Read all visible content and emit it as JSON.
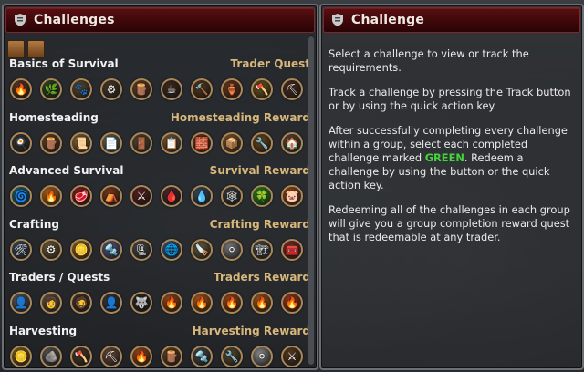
{
  "left_panel": {
    "title": "Challenges",
    "groups": [
      {
        "name": "Basics of Survival",
        "reward": "Trader Quest",
        "icons": [
          {
            "icon": "🔥",
            "color": "#5a3a20"
          },
          {
            "icon": "🌿",
            "color": "#2f4a23"
          },
          {
            "icon": "🐾",
            "color": "#5a4a30"
          },
          {
            "icon": "⚙",
            "color": "#4a3a28"
          },
          {
            "icon": "🪵",
            "color": "#6a4425"
          },
          {
            "icon": "☕",
            "color": "#3e2a1e"
          },
          {
            "icon": "🔨",
            "color": "#5a3a1e"
          },
          {
            "icon": "🏺",
            "color": "#6e3a1c"
          },
          {
            "icon": "🪓",
            "color": "#6d5a20"
          },
          {
            "icon": "⛏",
            "color": "#4a2c20"
          }
        ]
      },
      {
        "name": "Homesteading",
        "reward": "Homesteading Reward",
        "icons": [
          {
            "icon": "🍳",
            "color": "#3a3a3a"
          },
          {
            "icon": "🪵",
            "color": "#6a4425"
          },
          {
            "icon": "📜",
            "color": "#8a6a3a"
          },
          {
            "icon": "📄",
            "color": "#7a6a4a"
          },
          {
            "icon": "🚪",
            "color": "#5a4a35"
          },
          {
            "icon": "📋",
            "color": "#7a6040"
          },
          {
            "icon": "🧱",
            "color": "#7a3a22"
          },
          {
            "icon": "📦",
            "color": "#8a5a2a"
          },
          {
            "icon": "🔧",
            "color": "#6a4a20"
          },
          {
            "icon": "🏠",
            "color": "#5a4a3a"
          }
        ]
      },
      {
        "name": "Advanced Survival",
        "reward": "Survival Reward",
        "icons": [
          {
            "icon": "🌀",
            "color": "#1c6a7a"
          },
          {
            "icon": "🔥",
            "color": "#b06a1a"
          },
          {
            "icon": "🥩",
            "color": "#8a1e1e"
          },
          {
            "icon": "⛺",
            "color": "#7a3a1a"
          },
          {
            "icon": "⚔",
            "color": "#5a2020"
          },
          {
            "icon": "🩸",
            "color": "#4a2a2a"
          },
          {
            "icon": "💧",
            "color": "#3a4a5a"
          },
          {
            "icon": "🕸",
            "color": "#3a3a3a"
          },
          {
            "icon": "🍀",
            "color": "#2a8a20"
          },
          {
            "icon": "🐷",
            "color": "#9a4a1a"
          }
        ]
      },
      {
        "name": "Crafting",
        "reward": "Crafting Reward",
        "icons": [
          {
            "icon": "🛠",
            "color": "#3a4a5a"
          },
          {
            "icon": "⚙",
            "color": "#6a5a3a"
          },
          {
            "icon": "🪙",
            "color": "#9a6a1a"
          },
          {
            "icon": "🔩",
            "color": "#5a5a8a"
          },
          {
            "icon": "🗜",
            "color": "#4a4a4a"
          },
          {
            "icon": "🌐",
            "color": "#3a5a8a"
          },
          {
            "icon": "🪚",
            "color": "#6a5a3a"
          },
          {
            "icon": "⚪",
            "color": "#7a7a7a"
          },
          {
            "icon": "🏗",
            "color": "#4a4a4a"
          },
          {
            "icon": "🧰",
            "color": "#8a2a2a"
          }
        ]
      },
      {
        "name": "Traders / Quests",
        "reward": "Traders Reward",
        "icons": [
          {
            "icon": "👤",
            "color": "#5a5a5a"
          },
          {
            "icon": "👩",
            "color": "#6a5a4a"
          },
          {
            "icon": "🧔",
            "color": "#4a3a2a"
          },
          {
            "icon": "👤",
            "color": "#3a3a3a"
          },
          {
            "icon": "🐺",
            "color": "#2a2a2a"
          },
          {
            "icon": "🔥",
            "color": "#a04a1a"
          },
          {
            "icon": "🔥",
            "color": "#b05a1a"
          },
          {
            "icon": "🔥",
            "color": "#9a4a1a"
          },
          {
            "icon": "🔥",
            "color": "#a05a1a"
          },
          {
            "icon": "🔥",
            "color": "#9a3a1a"
          }
        ]
      },
      {
        "name": "Harvesting",
        "reward": "Harvesting Reward",
        "icons": [
          {
            "icon": "🪙",
            "color": "#8a6a1a"
          },
          {
            "icon": "🪨",
            "color": "#5a5a5a"
          },
          {
            "icon": "🪓",
            "color": "#4a3a2a"
          },
          {
            "icon": "⛏",
            "color": "#6a4a3a"
          },
          {
            "icon": "🔥",
            "color": "#9a4a1a"
          },
          {
            "icon": "🪵",
            "color": "#6a4425"
          },
          {
            "icon": "🔩",
            "color": "#4a4a4a"
          },
          {
            "icon": "🔧",
            "color": "#5a4a30"
          },
          {
            "icon": "⚪",
            "color": "#8a8a8a"
          },
          {
            "icon": "⚔",
            "color": "#5a3a20"
          }
        ]
      }
    ]
  },
  "right_panel": {
    "title": "Challenge",
    "paragraphs": [
      {
        "before": "Select a challenge to view or track the requirements.",
        "highlight": "",
        "after": ""
      },
      {
        "before": "Track a challenge by pressing the Track button or by using the quick action key.",
        "highlight": "",
        "after": ""
      },
      {
        "before": "After successfully completing every challenge within a group, select each completed challenge marked ",
        "highlight": "GREEN",
        "after": ". Redeem a challenge by using the button or the quick action key."
      },
      {
        "before": "Redeeming all of the challenges in each group will give you a group completion reward quest that is redeemable at any trader.",
        "highlight": "",
        "after": ""
      }
    ]
  },
  "colors": {
    "header_red": "#4a0a0d",
    "reward_gold": "#d8b77a",
    "green_text": "#44d43c",
    "icon_border": "#a8875a"
  }
}
